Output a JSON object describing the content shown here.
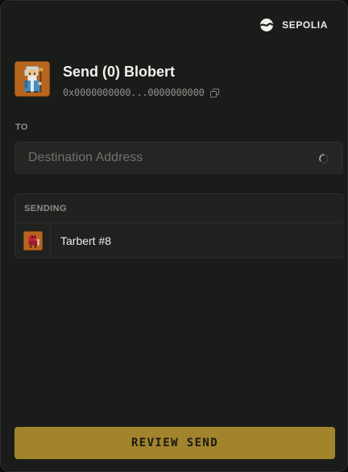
{
  "network": {
    "label": "SEPOLIA",
    "icon": "network-globe-icon"
  },
  "header": {
    "title": "Send (0) Blobert",
    "address": "0x0000000000...0000000000",
    "avatar_icon": "blobert-avatar"
  },
  "destination": {
    "label": "TO",
    "placeholder": "Destination Address",
    "value": ""
  },
  "sending": {
    "label": "SENDING",
    "items": [
      {
        "name": "Tarbert #8",
        "thumb_icon": "tarbert-thumbnail"
      }
    ]
  },
  "actions": {
    "review_label": "REVIEW SEND"
  },
  "colors": {
    "background": "#1a1c1a",
    "panel": "#242624",
    "accent": "#a2842c",
    "avatar_bg": "#b6661f",
    "muted_text": "#8d8f8b"
  }
}
